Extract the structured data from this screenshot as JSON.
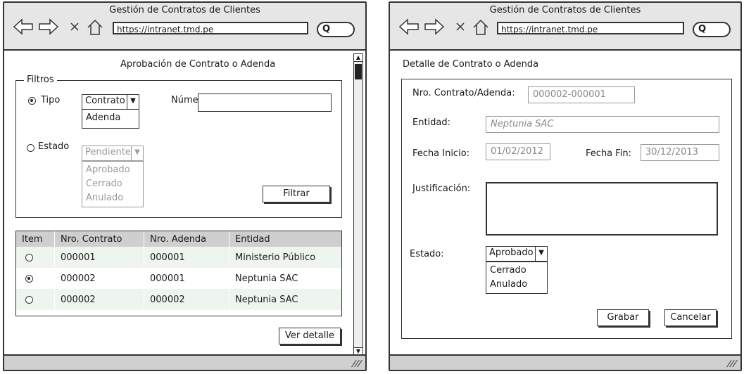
{
  "left": {
    "window_title": "Gestión de Contratos de Clientes",
    "url": "https://intranet.tmd.pe",
    "page_title": "Aprobación de Contrato o Adenda",
    "filters": {
      "legend": "Filtros",
      "tipo_label": "Tipo",
      "tipo_selected": "Contrato",
      "tipo_options": [
        "Adenda"
      ],
      "numero_label": "Número:",
      "estado_label": "Estado",
      "estado_selected": "Pendiente",
      "estado_options": [
        "Aprobado",
        "Cerrado",
        "Anulado"
      ],
      "filter_button": "Filtrar"
    },
    "table": {
      "headers": [
        "Item",
        "Nro. Contrato",
        "Nro. Adenda",
        "Entidad"
      ],
      "rows": [
        {
          "selected": false,
          "contrato": "000001",
          "adenda": "000001",
          "entidad": "Ministerio Público"
        },
        {
          "selected": true,
          "contrato": "000002",
          "adenda": "000001",
          "entidad": "Neptunia SAC"
        },
        {
          "selected": false,
          "contrato": "000002",
          "adenda": "000002",
          "entidad": "Neptunia SAC"
        }
      ]
    },
    "detail_button": "Ver detalle"
  },
  "right": {
    "window_title": "Gestión de Contratos de Clientes",
    "url": "https://intranet.tmd.pe",
    "page_title": "Detalle de Contrato o Adenda",
    "nro_label": "Nro. Contrato/Adenda:",
    "nro_value": "000002-000001",
    "entidad_label": "Entidad:",
    "entidad_value": "Neptunia SAC",
    "fecha_inicio_label": "Fecha Inicio:",
    "fecha_inicio_value": "01/02/2012",
    "fecha_fin_label": "Fecha Fin:",
    "fecha_fin_value": "30/12/2013",
    "justificacion_label": "Justificación:",
    "estado_label": "Estado:",
    "estado_selected": "Aprobado",
    "estado_options": [
      "Cerrado",
      "Anulado"
    ],
    "save_button": "Grabar",
    "cancel_button": "Cancelar"
  }
}
